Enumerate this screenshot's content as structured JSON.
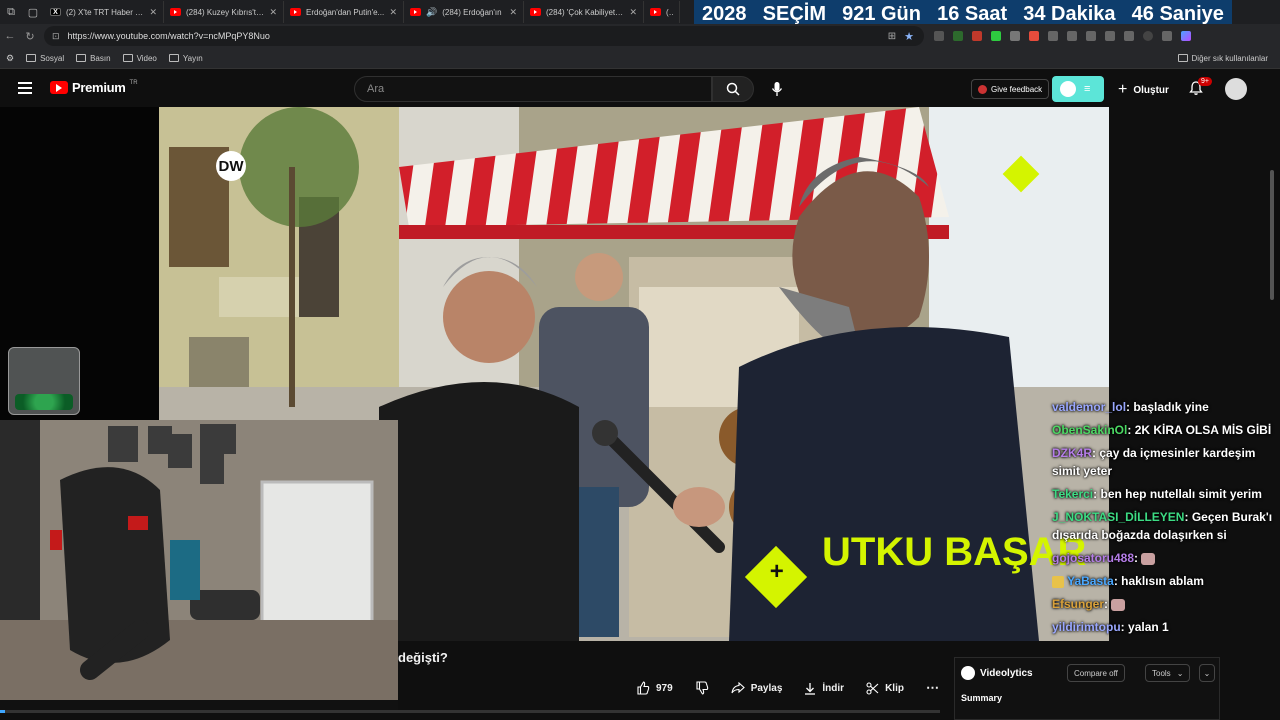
{
  "browser": {
    "tabs": [
      {
        "title": "(2) X'te TRT Haber Can",
        "favicon": "x-logo-icon"
      },
      {
        "title": "(284) Kuzey Kıbrıs'ta s",
        "favicon": "youtube-icon"
      },
      {
        "title": "Erdoğan'dan Putin'e...",
        "favicon": "youtube-icon"
      },
      {
        "title": "(284) Erdoğan'ın",
        "favicon": "youtube-icon"
      },
      {
        "title": "(284) 'Çok Kabiliyetli E",
        "favicon": "youtube-icon"
      },
      {
        "title": "(284",
        "favicon": "youtube-icon"
      }
    ],
    "url": "https://www.youtube.com/watch?v=ncMPqPY8Nuo",
    "bookmarks": [
      "Sosyal",
      "Basın",
      "Video",
      "Yayın"
    ],
    "other_bookmarks": "Diğer sık kullanılanlar"
  },
  "countdown": {
    "year_label": "2028",
    "event_label": "SEÇİM",
    "days": "921 Gün",
    "hours": "16 Saat",
    "minutes": "34 Dakika",
    "seconds": "46 Saniye"
  },
  "youtube": {
    "logo_text": "Premium",
    "logo_region": "TR",
    "search_placeholder": "Ara",
    "feedback_label": "Give feedback",
    "create_label": "Oluştur",
    "notification_count": "9+"
  },
  "video": {
    "channel_watermark": "DW",
    "reporter_name": "UTKU BAŞAR",
    "title_fragment": "değişti?",
    "likes": "979",
    "share_label": "Paylaş",
    "download_label": "İndir",
    "clip_label": "Klip",
    "progress": 0.005
  },
  "chat": [
    {
      "user": "valdemor_lol",
      "text": "başladık yine",
      "color": "#9aa8ff"
    },
    {
      "user": "ObenSakinOl",
      "text": "2K KİRA OLSA MİS GİBİ",
      "color": "#4cd964"
    },
    {
      "user": "DZK4R",
      "text": "çay da içmesinler kardeşim simit yeter",
      "color": "#b57de8"
    },
    {
      "user": "Tekerci",
      "text": "ben hep nutellalı simit yerim",
      "color": "#3ddc84"
    },
    {
      "user": "J_NOKTASI_DİLLEYEN",
      "text": "Geçen Burak'ı dışarıda boğazda dolaşırken si",
      "color": "#3ddc84"
    },
    {
      "user": "gojosatoru488",
      "text": "",
      "color": "#b57de8"
    },
    {
      "user": "YaBasta",
      "text": "haklısın ablam",
      "color": "#4aa8ff"
    },
    {
      "user": "Efsunger",
      "text": "",
      "color": "#d9a13a"
    },
    {
      "user": "yildirimtopu",
      "text": "yalan 1",
      "color": "#9aa8ff"
    }
  ],
  "videolytics": {
    "title": "Videolytics",
    "compare_label": "Compare off",
    "tools_label": "Tools",
    "summary_label": "Summary"
  }
}
